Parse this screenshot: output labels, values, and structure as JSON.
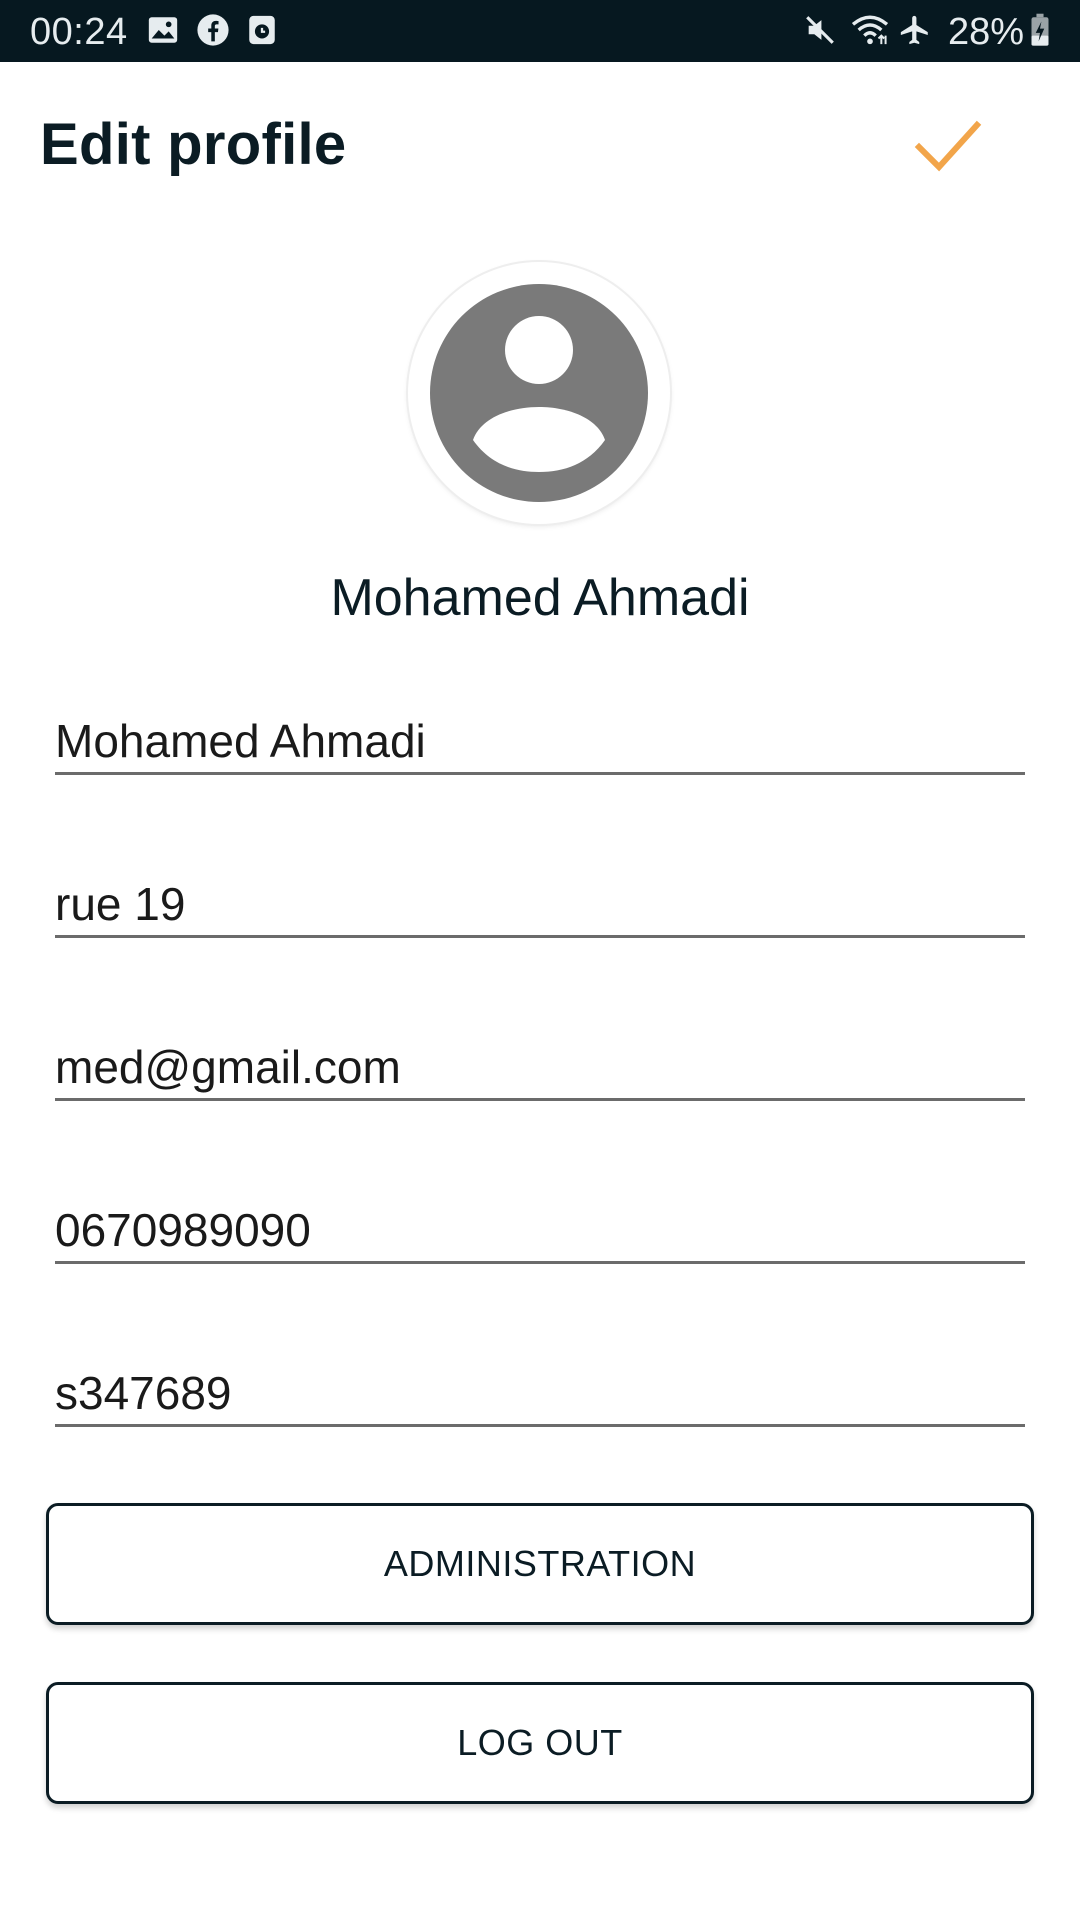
{
  "status_bar": {
    "time": "00:24",
    "battery_percent": "28%",
    "left_icons": [
      "image-icon",
      "facebook-icon",
      "clock-app-icon"
    ],
    "right_icons": [
      "mute-icon",
      "wifi-icon",
      "airplane-mode-icon",
      "battery-charging-icon"
    ]
  },
  "header": {
    "title": "Edit profile",
    "confirm_icon": "checkmark-icon"
  },
  "profile": {
    "avatar_icon": "account-circle-icon",
    "display_name": "Mohamed Ahmadi"
  },
  "form": {
    "name": "Mohamed Ahmadi",
    "address": "rue 19",
    "email": "med@gmail.com",
    "phone": "0670989090",
    "code": "s347689"
  },
  "buttons": {
    "administration": "ADMINISTRATION",
    "logout": "LOG OUT"
  },
  "colors": {
    "status_bar_bg": "#061820",
    "accent": "#F2A54A",
    "text_primary": "#0B1C24",
    "avatar_gray": "#7A7A7A"
  }
}
